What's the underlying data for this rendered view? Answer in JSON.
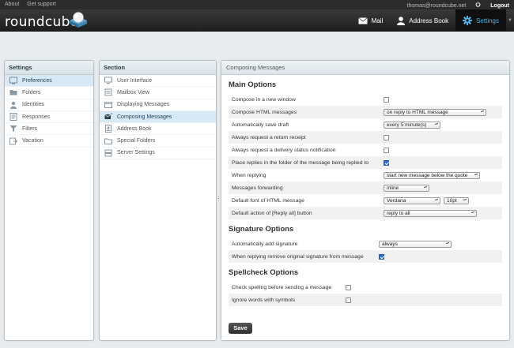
{
  "topbar": {
    "about": "About",
    "support": "Get support",
    "user": "thomas@roundcube.net",
    "logout": "Logout"
  },
  "header": {
    "logo_text": "roundcube",
    "nav": {
      "mail": "Mail",
      "addressbook": "Address Book",
      "settings": "Settings"
    }
  },
  "settings_panel": {
    "title": "Settings",
    "items": [
      {
        "label": "Preferences",
        "icon": "preferences-icon"
      },
      {
        "label": "Folders",
        "icon": "folder-icon"
      },
      {
        "label": "Identities",
        "icon": "identities-icon"
      },
      {
        "label": "Responses",
        "icon": "responses-icon"
      },
      {
        "label": "Filters",
        "icon": "filter-icon"
      },
      {
        "label": "Vacation",
        "icon": "vacation-icon"
      }
    ]
  },
  "section_panel": {
    "title": "Section",
    "items": [
      {
        "label": "User Interface",
        "icon": "monitor-icon"
      },
      {
        "label": "Mailbox View",
        "icon": "mailbox-icon"
      },
      {
        "label": "Displaying Messages",
        "icon": "display-icon"
      },
      {
        "label": "Composing Messages",
        "icon": "compose-icon"
      },
      {
        "label": "Address Book",
        "icon": "addressbook-icon"
      },
      {
        "label": "Special Folders",
        "icon": "special-folders-icon"
      },
      {
        "label": "Server Settings",
        "icon": "server-icon"
      }
    ]
  },
  "content": {
    "title": "Composing Messages",
    "main_options": {
      "legend": "Main Options",
      "rows": [
        {
          "label": "Compose in a new window",
          "checked": false
        },
        {
          "label": "Compose HTML messages",
          "select": "on reply to HTML message"
        },
        {
          "label": "Automatically save draft",
          "select": "every 5 minute(s)"
        },
        {
          "label": "Always request a return receipt",
          "checked": false
        },
        {
          "label": "Always request a delivery status notification",
          "checked": false
        },
        {
          "label": "Place replies in the folder of the message being replied to",
          "checked": true
        },
        {
          "label": "When replying",
          "select": "start new message below the quote"
        },
        {
          "label": "Messages forwarding",
          "select": "inline"
        },
        {
          "label": "Default font of HTML message",
          "select": "Verdana",
          "select2": "10pt"
        },
        {
          "label": "Default action of [Reply all] button",
          "select": "reply to all"
        }
      ]
    },
    "signature_options": {
      "legend": "Signature Options",
      "rows": [
        {
          "label": "Automatically add signature",
          "select": "always"
        },
        {
          "label": "When replying remove original signature from message",
          "checked": true
        }
      ]
    },
    "spellcheck_options": {
      "legend": "Spellcheck Options",
      "rows": [
        {
          "label": "Check spelling before sending a message",
          "checked": false
        },
        {
          "label": "Ignore words with symbols",
          "checked": false
        }
      ]
    },
    "save_label": "Save"
  },
  "colors": {
    "accent": "#4fb3e8",
    "selected_row": "#d6e9f5",
    "header_bg": "#2a2a2a",
    "checkbox_checked": "#2d6fd4"
  }
}
